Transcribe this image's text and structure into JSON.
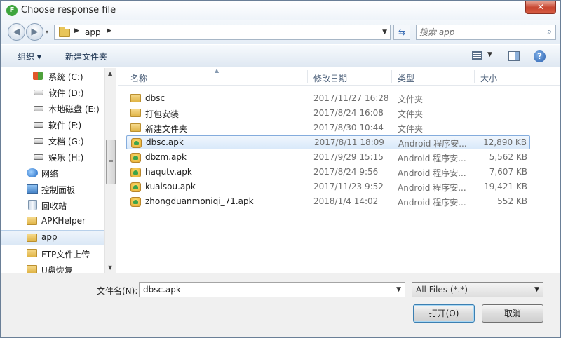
{
  "window": {
    "title": "Choose response file",
    "app_icon": "F",
    "close_glyph": "✕"
  },
  "address": {
    "back_glyph": "◀",
    "forward_glyph": "▶",
    "path": [
      "app"
    ],
    "search_placeholder": "搜索 app",
    "refresh_glyph": "⇆",
    "search_glyph": "⌕"
  },
  "toolbar": {
    "organize": "组织 ▾",
    "new_folder": "新建文件夹",
    "help": "?"
  },
  "nav": {
    "items": [
      {
        "label": "系统 (C:)",
        "icon": "windows-drive-icon"
      },
      {
        "label": "软件 (D:)",
        "icon": "drive-icon"
      },
      {
        "label": "本地磁盘 (E:)",
        "icon": "drive-icon"
      },
      {
        "label": "软件 (F:)",
        "icon": "drive-icon"
      },
      {
        "label": "文档 (G:)",
        "icon": "drive-icon"
      },
      {
        "label": "娱乐 (H:)",
        "icon": "drive-icon"
      },
      {
        "label": "网络",
        "icon": "network-icon"
      },
      {
        "label": "控制面板",
        "icon": "control-panel-icon"
      },
      {
        "label": "回收站",
        "icon": "recycle-bin-icon"
      },
      {
        "label": "APKHelper",
        "icon": "folder-icon"
      },
      {
        "label": "app",
        "icon": "folder-icon",
        "selected": true
      },
      {
        "label": "FTP文件上传",
        "icon": "folder-icon"
      },
      {
        "label": "U盘恢复",
        "icon": "folder-icon"
      }
    ]
  },
  "files": {
    "columns": {
      "name": "名称",
      "date": "修改日期",
      "type": "类型",
      "size": "大小"
    },
    "rows": [
      {
        "name": "dbsc",
        "date": "2017/11/27 16:28",
        "type": "文件夹",
        "size": "",
        "icon": "folder-icon"
      },
      {
        "name": "打包安装",
        "date": "2017/8/24 16:08",
        "type": "文件夹",
        "size": "",
        "icon": "folder-icon"
      },
      {
        "name": "新建文件夹",
        "date": "2017/8/30 10:44",
        "type": "文件夹",
        "size": "",
        "icon": "folder-icon"
      },
      {
        "name": "dbsc.apk",
        "date": "2017/8/11 18:09",
        "type": "Android 程序安...",
        "size": "12,890 KB",
        "icon": "apk-icon",
        "selected": true
      },
      {
        "name": "dbzm.apk",
        "date": "2017/9/29 15:15",
        "type": "Android 程序安...",
        "size": "5,562 KB",
        "icon": "apk-icon"
      },
      {
        "name": "haqutv.apk",
        "date": "2017/8/24 9:56",
        "type": "Android 程序安...",
        "size": "7,607 KB",
        "icon": "apk-icon"
      },
      {
        "name": "kuaisou.apk",
        "date": "2017/11/23 9:52",
        "type": "Android 程序安...",
        "size": "19,421 KB",
        "icon": "apk-icon"
      },
      {
        "name": "zhongduanmoniqi_71.apk",
        "date": "2018/1/4 14:02",
        "type": "Android 程序安...",
        "size": "552 KB",
        "icon": "apk-icon"
      }
    ]
  },
  "footer": {
    "filename_label": "文件名(N):",
    "filename_value": "dbsc.apk",
    "filter_value": "All Files (*.*)",
    "open_label": "打开(O)",
    "cancel_label": "取消"
  },
  "colors": {
    "selection": "#d9e9fa",
    "selection_border": "#84acdd",
    "close": "#c7452f"
  }
}
